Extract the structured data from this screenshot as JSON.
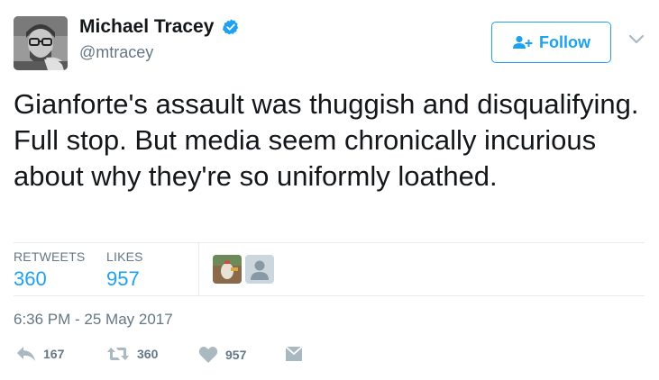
{
  "user": {
    "display_name": "Michael Tracey",
    "handle": "@mtracey",
    "verified": true
  },
  "follow_button": {
    "label": "Follow"
  },
  "tweet": {
    "text": "Gianforte's assault was thuggish and disqualifying. Full stop. But media seem chronically incurious about why they're so uniformly loathed."
  },
  "stats": {
    "retweets_label": "RETWEETS",
    "retweets_count": "360",
    "likes_label": "LIKES",
    "likes_count": "957"
  },
  "timestamp": "6:36 PM - 25 May 2017",
  "actions": {
    "reply_count": "167",
    "retweet_count": "360",
    "like_count": "957"
  },
  "icons": {
    "verified": "verified-badge-icon",
    "follow": "person-add-icon",
    "more": "chevron-down-icon",
    "reply": "reply-icon",
    "retweet": "retweet-icon",
    "like": "heart-icon",
    "message": "direct-message-icon"
  },
  "colors": {
    "accent": "#1da1f2",
    "secondary_text": "#657786",
    "primary_text": "#14171a",
    "divider": "#e6ecf0"
  }
}
